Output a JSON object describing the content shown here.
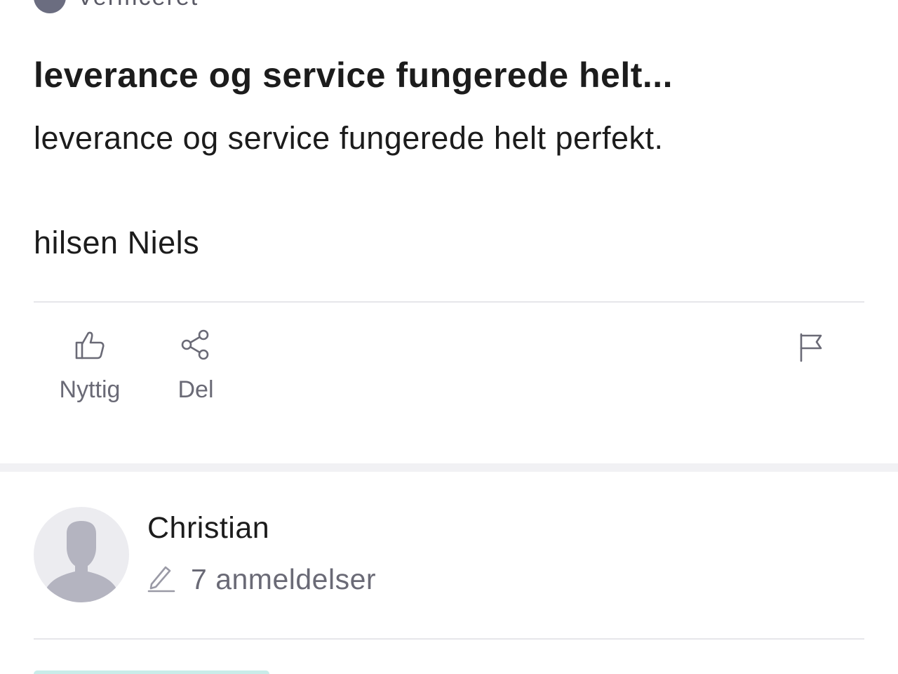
{
  "verified": {
    "label": "Verificeret"
  },
  "review": {
    "title": "leverance og service fungerede helt...",
    "body_lines": [
      "leverance og service fungerede helt perfekt.",
      "hilsen Niels"
    ]
  },
  "actions": {
    "useful_label": "Nyttig",
    "useful_icon": "thumbs-up-icon",
    "share_label": "Del",
    "share_icon": "share-icon",
    "flag_icon": "flag-icon"
  },
  "next_review": {
    "reviewer_name": "Christian",
    "review_count": "7 anmeldelser",
    "avatar_icon": "person-silhouette-icon",
    "count_icon": "pencil-icon"
  },
  "colors": {
    "text": "#1c1c1c",
    "muted": "#6a6a76",
    "divider": "#e6e6ea",
    "avatar_bg": "#ececf0",
    "avatar_figure": "#b4b4c0"
  }
}
